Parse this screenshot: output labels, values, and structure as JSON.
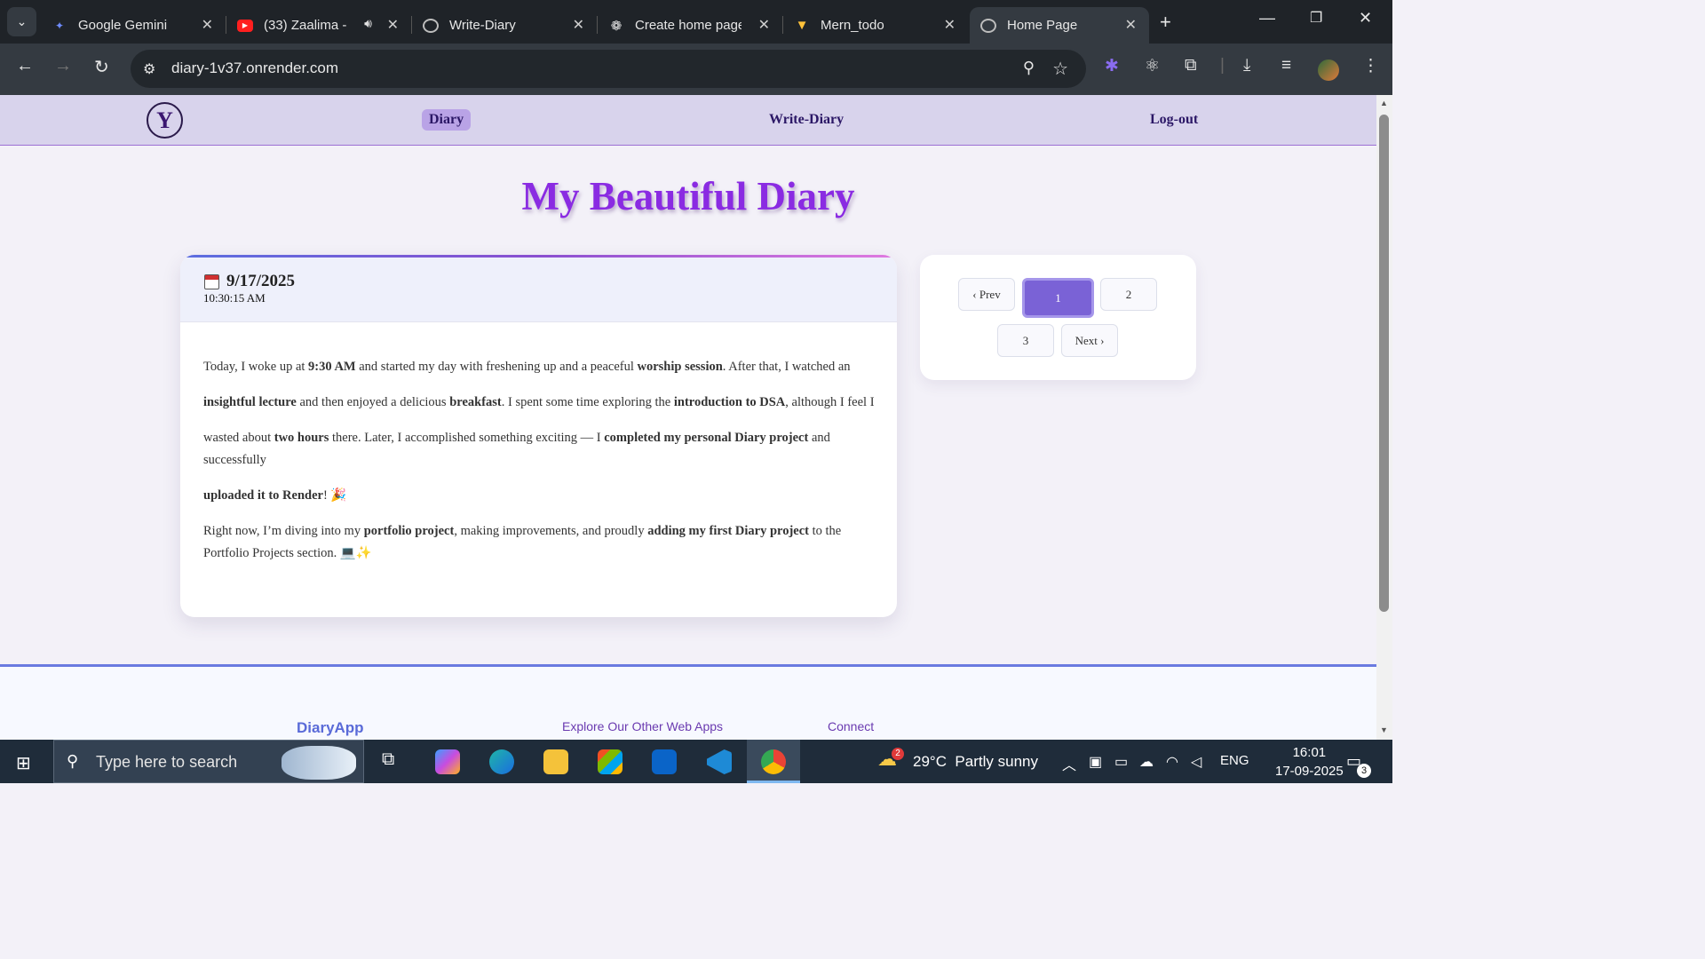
{
  "browser": {
    "tabs": [
      {
        "title": "Google Gemini",
        "icon": "gemini-icon",
        "color": "#6f8cff"
      },
      {
        "title": "(33) Zaalima - ",
        "icon": "youtube-icon",
        "color": "#ff2a2a"
      },
      {
        "title": "Write-Diary",
        "icon": "globe-icon",
        "color": "#bdbdbd"
      },
      {
        "title": "Create home page",
        "icon": "openai-icon",
        "color": "#e6e6e6"
      },
      {
        "title": "Mern_todo",
        "icon": "vite-icon",
        "color": "#ffc23a"
      },
      {
        "title": "Home Page",
        "icon": "globe-icon",
        "color": "#bdbdbd"
      }
    ],
    "url": "diary-1v37.onrender.com"
  },
  "site": {
    "logo_letter": "Y",
    "nav": {
      "diary": "Diary",
      "write": "Write-Diary",
      "logout": "Log-out"
    },
    "heading": "My Beautiful Diary",
    "entry": {
      "date": "9/17/2025",
      "time": "10:30:15 AM",
      "p1": [
        {
          "t": "Today, I woke up at ",
          "b": false
        },
        {
          "t": "9:30 AM",
          "b": true
        },
        {
          "t": " and started my day with freshening up and a peaceful ",
          "b": false
        },
        {
          "t": "worship session",
          "b": true
        },
        {
          "t": ". After that, I watched an",
          "b": false
        }
      ],
      "p2": [
        {
          "t": "insightful lecture",
          "b": true
        },
        {
          "t": " and then enjoyed a delicious ",
          "b": false
        },
        {
          "t": "breakfast",
          "b": true
        },
        {
          "t": ". I spent some time exploring the ",
          "b": false
        },
        {
          "t": "introduction to DSA",
          "b": true
        },
        {
          "t": ", although I feel I",
          "b": false
        }
      ],
      "p3": [
        {
          "t": "wasted about ",
          "b": false
        },
        {
          "t": "two hours",
          "b": true
        },
        {
          "t": " there. Later, I accomplished something exciting — I ",
          "b": false
        },
        {
          "t": "completed my personal Diary project",
          "b": true
        },
        {
          "t": " and successfully",
          "b": false
        }
      ],
      "p4": [
        {
          "t": "uploaded it to Render",
          "b": true
        },
        {
          "t": "! 🎉",
          "b": false
        }
      ],
      "p5": [
        {
          "t": "Right now, I’m diving into my ",
          "b": false
        },
        {
          "t": "portfolio project",
          "b": true
        },
        {
          "t": ", making improvements, and proudly ",
          "b": false
        },
        {
          "t": "adding my first Diary project",
          "b": true
        },
        {
          "t": " to the Portfolio Projects section. 💻✨",
          "b": false
        }
      ]
    },
    "pagination": {
      "prev": "‹ Prev",
      "p1": "1",
      "p2": "2",
      "p3": "3",
      "next": "Next ›",
      "current": "1"
    },
    "footer": {
      "brand": "DiaryApp",
      "explore": "Explore Our Other Web Apps",
      "connect": "Connect"
    }
  },
  "taskbar": {
    "search_placeholder": "Type here to search",
    "weather": "29°C  Partly sunny",
    "weather_badge": "2",
    "lang": "ENG",
    "time": "16:01",
    "date": "17-09-2025",
    "notifications": "3"
  }
}
